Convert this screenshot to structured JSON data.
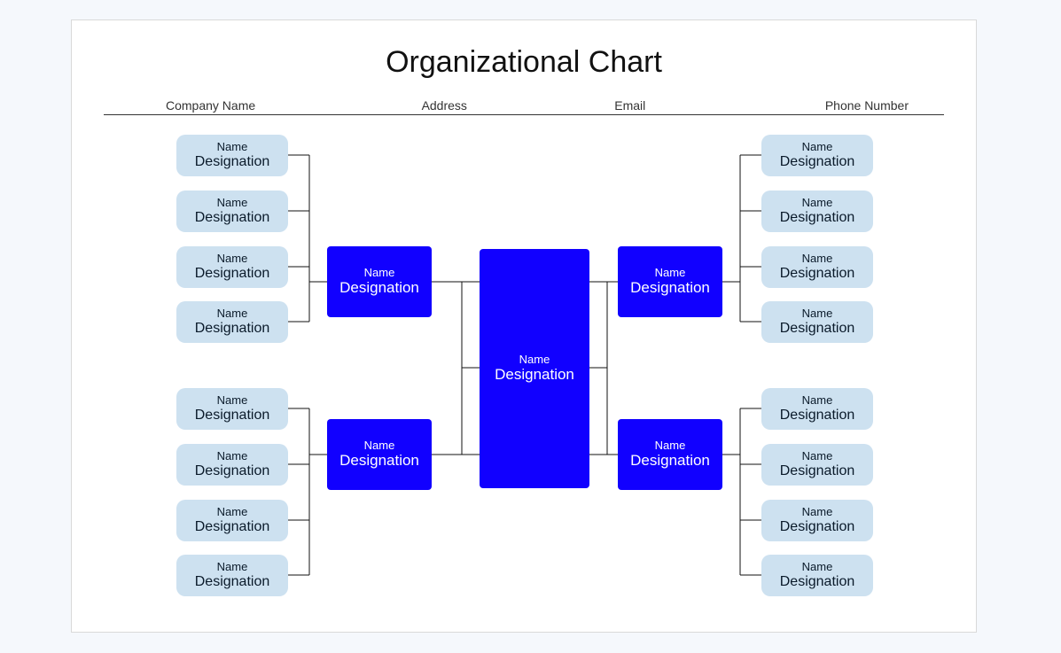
{
  "title": "Organizational Chart",
  "headers": {
    "company": "Company Name",
    "address": "Address",
    "email": "Email",
    "phone": "Phone Number"
  },
  "chart_data": {
    "type": "tree",
    "root": {
      "name": "Name",
      "designation": "Designation"
    },
    "branches": [
      {
        "id": "left_top",
        "name": "Name",
        "designation": "Designation",
        "leaves": [
          {
            "name": "Name",
            "designation": "Designation"
          },
          {
            "name": "Name",
            "designation": "Designation"
          },
          {
            "name": "Name",
            "designation": "Designation"
          },
          {
            "name": "Name",
            "designation": "Designation"
          }
        ]
      },
      {
        "id": "left_bottom",
        "name": "Name",
        "designation": "Designation",
        "leaves": [
          {
            "name": "Name",
            "designation": "Designation"
          },
          {
            "name": "Name",
            "designation": "Designation"
          },
          {
            "name": "Name",
            "designation": "Designation"
          },
          {
            "name": "Name",
            "designation": "Designation"
          }
        ]
      },
      {
        "id": "right_top",
        "name": "Name",
        "designation": "Designation",
        "leaves": [
          {
            "name": "Name",
            "designation": "Designation"
          },
          {
            "name": "Name",
            "designation": "Designation"
          },
          {
            "name": "Name",
            "designation": "Designation"
          },
          {
            "name": "Name",
            "designation": "Designation"
          }
        ]
      },
      {
        "id": "right_bottom",
        "name": "Name",
        "designation": "Designation",
        "leaves": [
          {
            "name": "Name",
            "designation": "Designation"
          },
          {
            "name": "Name",
            "designation": "Designation"
          },
          {
            "name": "Name",
            "designation": "Designation"
          },
          {
            "name": "Name",
            "designation": "Designation"
          }
        ]
      }
    ]
  }
}
